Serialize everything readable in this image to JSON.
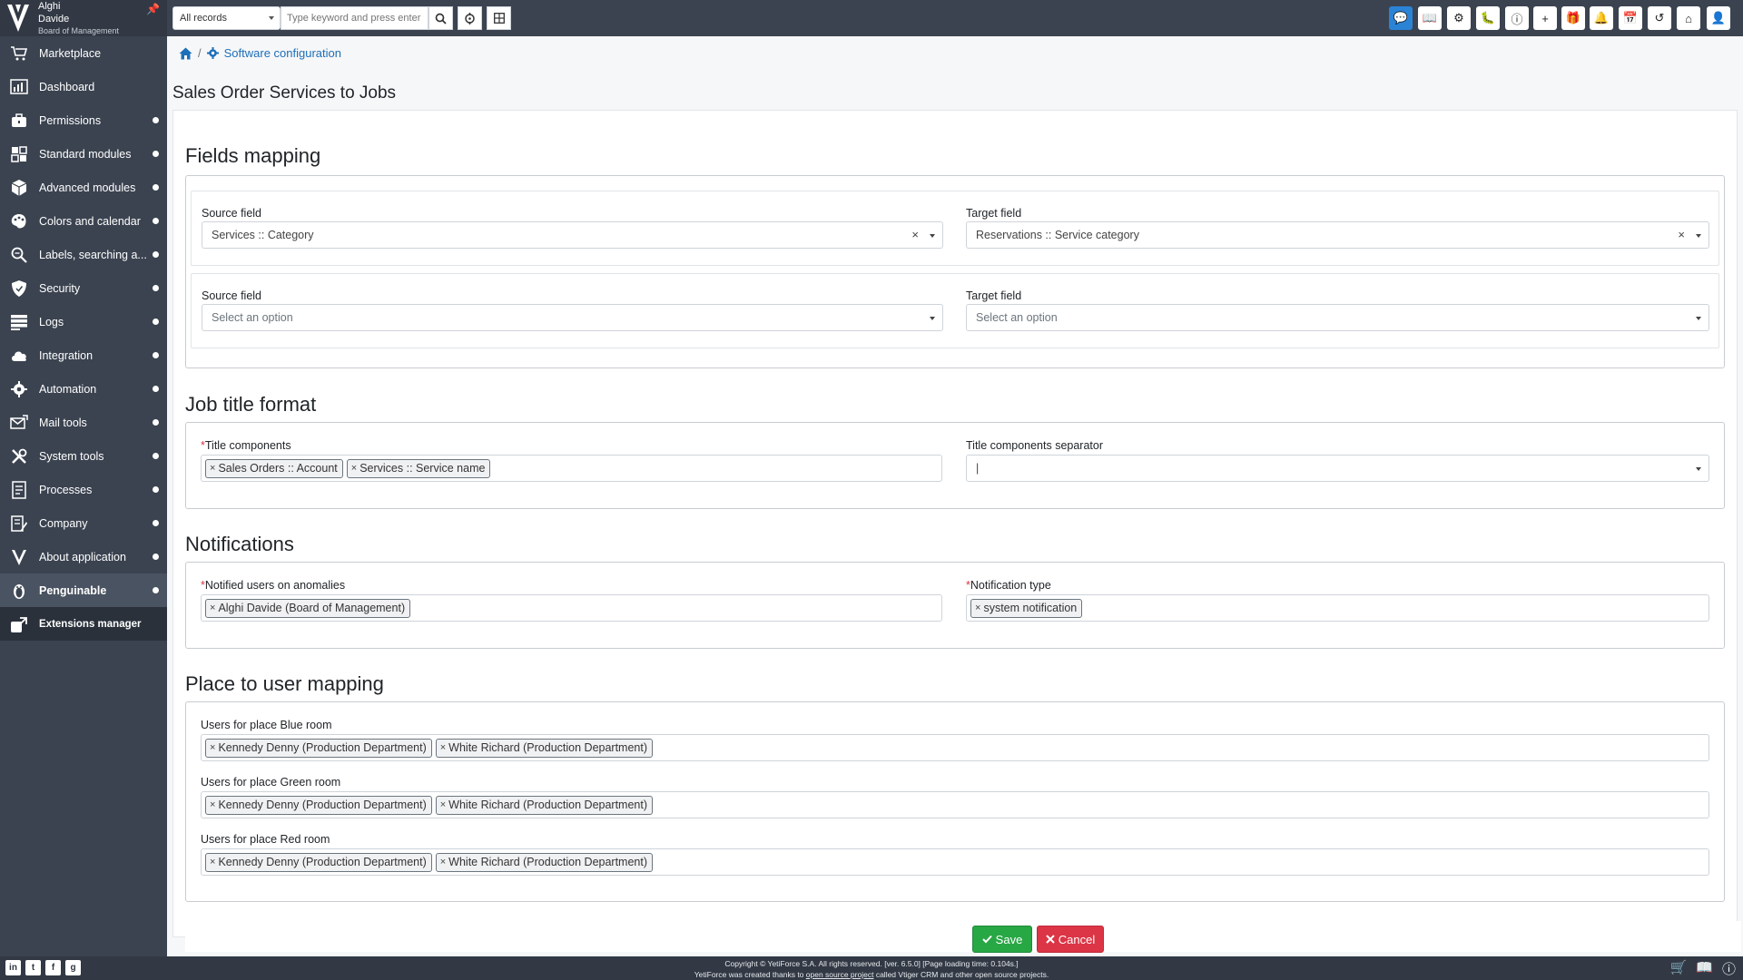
{
  "user": {
    "first_name": "Alghi",
    "last_name": "Davide",
    "role": "Board of Management"
  },
  "sidebar": {
    "items": [
      {
        "label": "Marketplace",
        "icon": "cart-icon"
      },
      {
        "label": "Dashboard",
        "icon": "dashboard-icon"
      },
      {
        "label": "Permissions",
        "icon": "briefcase-lock-icon"
      },
      {
        "label": "Standard modules",
        "icon": "modules-icon"
      },
      {
        "label": "Advanced modules",
        "icon": "cube-icon"
      },
      {
        "label": "Colors and calendar",
        "icon": "palette-icon"
      },
      {
        "label": "Labels, searching a...",
        "icon": "search-text-icon"
      },
      {
        "label": "Security",
        "icon": "shield-icon"
      },
      {
        "label": "Logs",
        "icon": "logs-icon"
      },
      {
        "label": "Integration",
        "icon": "cloud-icon"
      },
      {
        "label": "Automation",
        "icon": "gears-icon"
      },
      {
        "label": "Mail tools",
        "icon": "mail-icon"
      },
      {
        "label": "System tools",
        "icon": "tools-icon"
      },
      {
        "label": "Processes",
        "icon": "processes-icon"
      },
      {
        "label": "Company",
        "icon": "company-icon"
      },
      {
        "label": "About application",
        "icon": "yetiforce-icon"
      },
      {
        "label": "Penguinable",
        "icon": "penguin-icon"
      },
      {
        "label": "Extensions manager",
        "icon": "extensions-icon"
      }
    ]
  },
  "topbar": {
    "records_select": "All records",
    "search_placeholder": "Type keyword and press enter",
    "quick_actions": [
      "chat-icon",
      "book-icon",
      "help-circle-icon",
      "bug-icon",
      "info-icon",
      "plus-icon",
      "gift-icon",
      "bell-icon",
      "calendar-icon",
      "history-icon",
      "home-lock-icon",
      "user-menu-icon"
    ]
  },
  "breadcrumb": {
    "current": "Software configuration"
  },
  "page": {
    "title": "Sales Order Services to Jobs"
  },
  "fields_mapping": {
    "title": "Fields mapping",
    "rows": [
      {
        "source_label": "Source field",
        "source_value": "Services :: Category",
        "target_label": "Target field",
        "target_value": "Reservations :: Service category"
      },
      {
        "source_label": "Source field",
        "source_placeholder": "Select an option",
        "target_label": "Target field",
        "target_placeholder": "Select an option"
      }
    ]
  },
  "job_title_format": {
    "title": "Job title format",
    "components_label": "Title components",
    "components": [
      "Sales Orders :: Account",
      "Services :: Service name"
    ],
    "separator_label": "Title components separator",
    "separator_value": "|"
  },
  "notifications": {
    "title": "Notifications",
    "users_label": "Notified users on anomalies",
    "users": [
      "Alghi Davide (Board of Management)"
    ],
    "type_label": "Notification type",
    "types": [
      "system notification"
    ]
  },
  "place_mapping": {
    "title": "Place to user mapping",
    "places": [
      {
        "label": "Users for place Blue room",
        "users": [
          "Kennedy Denny (Production Department)",
          "White Richard (Production Department)"
        ]
      },
      {
        "label": "Users for place Green room",
        "users": [
          "Kennedy Denny (Production Department)",
          "White Richard (Production Department)"
        ]
      },
      {
        "label": "Users for place Red room",
        "users": [
          "Kennedy Denny (Production Department)",
          "White Richard (Production Department)"
        ]
      }
    ]
  },
  "actions": {
    "save": "Save",
    "cancel": "Cancel"
  },
  "footer": {
    "line1": "Copyright © YetiForce S.A. All rights reserved. [ver. 6.5.0] [Page loading time: 0.104s.]",
    "line2_pre": "YetiForce was created thanks to",
    "line2_link": "open source project",
    "line2_post": "called Vtiger CRM and other open source projects."
  },
  "colors": {
    "sidebar": "#3b4350",
    "accent": "#2b83d6",
    "save": "#28a745",
    "cancel": "#dc3545"
  }
}
